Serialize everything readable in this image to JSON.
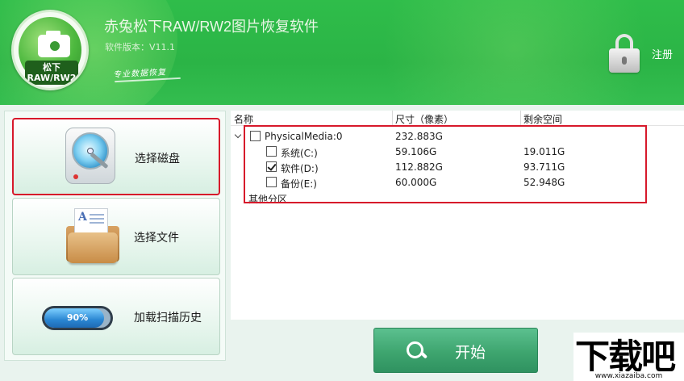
{
  "header": {
    "title": "赤兔松下RAW/RW2图片恢复软件",
    "version": "软件版本：V11.1",
    "slogan": "专业数据恢复",
    "logo_top": "松下",
    "logo_bottom": "RAW/RW2",
    "register_label": "注册"
  },
  "sidebar": {
    "items": [
      {
        "label": "选择磁盘",
        "icon": "hard-disk-icon",
        "selected": true
      },
      {
        "label": "选择文件",
        "icon": "folder-document-icon",
        "selected": false
      },
      {
        "label": "加载扫描历史",
        "icon": "progress-bar-icon",
        "selected": false,
        "progress_text": "90%",
        "progress": 0.9
      }
    ]
  },
  "table": {
    "columns": [
      "名称",
      "尺寸（像素）",
      "剩余空间"
    ],
    "rows": [
      {
        "name": "PhysicalMedia:0",
        "size": "232.883G",
        "free": "",
        "checked": false,
        "level": 0
      },
      {
        "name": "系统(C:)",
        "size": "59.106G",
        "free": "19.011G",
        "checked": false,
        "level": 1
      },
      {
        "name": "软件(D:)",
        "size": "112.882G",
        "free": "93.711G",
        "checked": true,
        "level": 1
      },
      {
        "name": "备份(E:)",
        "size": "60.000G",
        "free": "52.948G",
        "checked": false,
        "level": 1
      }
    ],
    "other_partitions": "其他分区"
  },
  "start_button": {
    "label": "开始",
    "icon": "search-icon"
  },
  "watermark": {
    "main": "下载吧",
    "url": "www.xiazaiba.com"
  },
  "colors": {
    "header_green": "#2fbd4a",
    "highlight_red": "#d7192b",
    "start_green": "#3ea56f",
    "progress_blue": "#2a86d2"
  }
}
